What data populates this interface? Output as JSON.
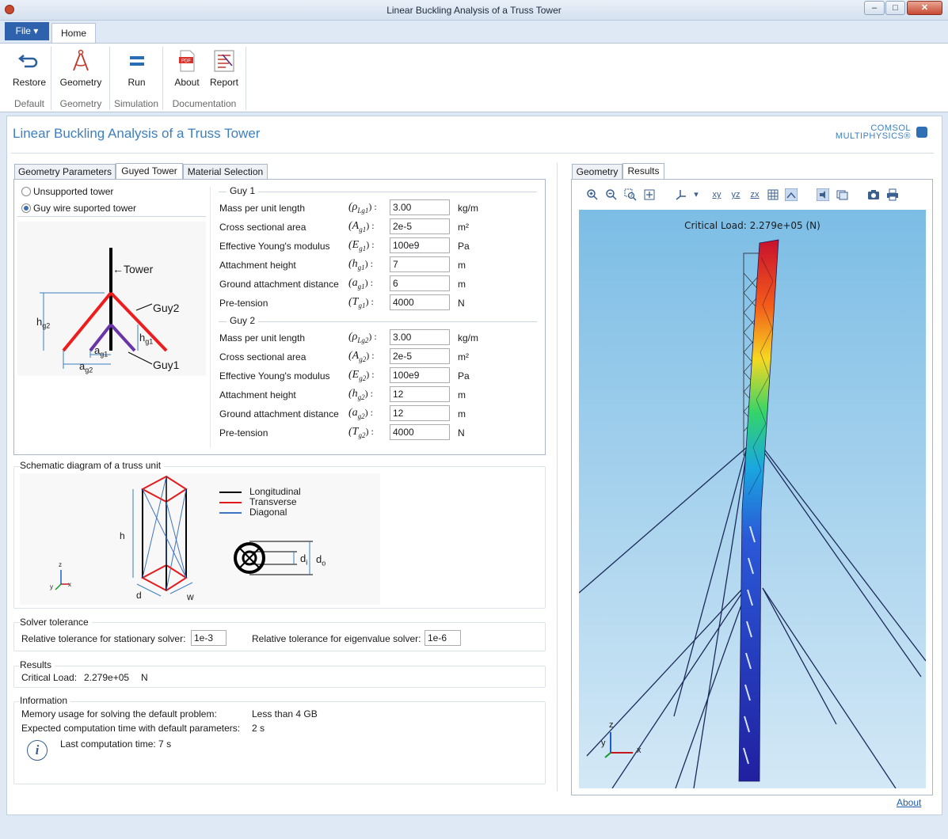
{
  "window": {
    "title": "Linear Buckling Analysis of a Truss Tower"
  },
  "ribbon": {
    "file_label": "File ▾",
    "home_tab": "Home",
    "buttons": [
      {
        "label": "Restore",
        "icon": "undo-arrow-icon"
      },
      {
        "label": "Geometry",
        "icon": "compass-icon"
      },
      {
        "label": "Run",
        "icon": "equals-run-icon"
      },
      {
        "label": "About",
        "icon": "pdf-icon"
      },
      {
        "label": "Report",
        "icon": "report-icon"
      }
    ],
    "groups": [
      "Default",
      "Geometry",
      "Simulation",
      "Documentation"
    ]
  },
  "app": {
    "title": "Linear Buckling Analysis of a  Truss Tower",
    "logo_line1": "COMSOL",
    "logo_line2": "MULTIPHYSICS®"
  },
  "left_tabs": [
    "Geometry Parameters",
    "Guyed Tower",
    "Material Selection"
  ],
  "options": {
    "unsupported": "Unsupported tower",
    "guyed": "Guy wire suported tower"
  },
  "guy_diagram": {
    "tower": "←Tower",
    "guy2": "Guy2",
    "guy1": "Guy1",
    "hg2": "h",
    "hg2_sub": "g2",
    "hg1": "h",
    "hg1_sub": "g1",
    "ag1": "a",
    "ag1_sub": "g1",
    "ag2": "a",
    "ag2_sub": "g2"
  },
  "guy1": {
    "title": "Guy 1",
    "rows": [
      {
        "label": "Mass per unit length",
        "sym": "(ρ",
        "sub": "Lg1",
        "close": ") :",
        "value": "3.00",
        "unit": "kg/m"
      },
      {
        "label": "Cross sectional area",
        "sym": "(A",
        "sub": "g1",
        "close": ") :",
        "value": "2e-5",
        "unit": "m²"
      },
      {
        "label": "Effective Young's modulus",
        "sym": "(E",
        "sub": "g1",
        "close": ") :",
        "value": "100e9",
        "unit": "Pa"
      },
      {
        "label": "Attachment height",
        "sym": "(h",
        "sub": "g1",
        "close": ") :",
        "value": "7",
        "unit": "m"
      },
      {
        "label": "Ground attachment distance",
        "sym": "(a",
        "sub": "g1",
        "close": ") :",
        "value": "6",
        "unit": "m"
      },
      {
        "label": "Pre-tension",
        "sym": "(T",
        "sub": "g1",
        "close": ") :",
        "value": "4000",
        "unit": "N"
      }
    ]
  },
  "guy2": {
    "title": "Guy 2",
    "rows": [
      {
        "label": "Mass per unit length",
        "sym": "(ρ",
        "sub": "Lg2",
        "close": ") :",
        "value": "3.00",
        "unit": "kg/m"
      },
      {
        "label": "Cross sectional area",
        "sym": "(A",
        "sub": "g2",
        "close": ") :",
        "value": "2e-5",
        "unit": "m²"
      },
      {
        "label": "Effective Young's modulus",
        "sym": "(E",
        "sub": "g2",
        "close": ") :",
        "value": "100e9",
        "unit": "Pa"
      },
      {
        "label": "Attachment height",
        "sym": "(h",
        "sub": "g2",
        "close": ") :",
        "value": "12",
        "unit": "m"
      },
      {
        "label": "Ground attachment distance",
        "sym": "(a",
        "sub": "g2",
        "close": ") :",
        "value": "12",
        "unit": "m"
      },
      {
        "label": "Pre-tension",
        "sym": "(T",
        "sub": "g2",
        "close": ") :",
        "value": "4000",
        "unit": "N"
      }
    ]
  },
  "schematic": {
    "title": "Schematic diagram of a truss unit",
    "legend": [
      "Longitudinal",
      "Transverse",
      "Diagonal"
    ],
    "legend_colors": [
      "#000000",
      "#e41a1c",
      "#3f74c4"
    ],
    "h": "h",
    "d": "d",
    "w": "w",
    "di": "d",
    "di_sub": "i",
    "do": "d",
    "do_sub": "o",
    "axes": [
      "z",
      "y",
      "x"
    ]
  },
  "solver": {
    "title": "Solver tolerance",
    "stationary_label": "Relative tolerance for stationary solver:",
    "stationary_value": "1e-3",
    "eigen_label": "Relative tolerance for eigenvalue solver:",
    "eigen_value": "1e-6"
  },
  "results": {
    "title": "Results",
    "label": "Critical Load:",
    "value": "2.279e+05",
    "unit": "N"
  },
  "info": {
    "title": "Information",
    "memory_label": "Memory usage for solving the default problem:",
    "memory_value": "Less than 4 GB",
    "time_label": "Expected computation time with default parameters:",
    "time_value": "2 s",
    "last_label": "Last computation time: 7 s"
  },
  "right_tabs": [
    "Geometry",
    "Results"
  ],
  "graphics": {
    "critical_load": "Critical Load: 2.279e+05 (N)",
    "axis_labels": [
      "z",
      "y",
      "x"
    ],
    "toolbar_icons": [
      "zoom-in-icon",
      "zoom-out-icon",
      "zoom-box-icon",
      "zoom-extents-icon",
      "axis-orient-icon",
      "xy-view-icon",
      "yz-view-icon",
      "zx-view-icon",
      "grid-icon",
      "scene-light-icon",
      "transparency-icon",
      "wireframe-icon",
      "camera-icon",
      "print-icon"
    ],
    "toolbar_texts": {
      "xy": "xy",
      "yz": "yz",
      "zx": "zx"
    }
  },
  "footer": {
    "about": "About"
  }
}
